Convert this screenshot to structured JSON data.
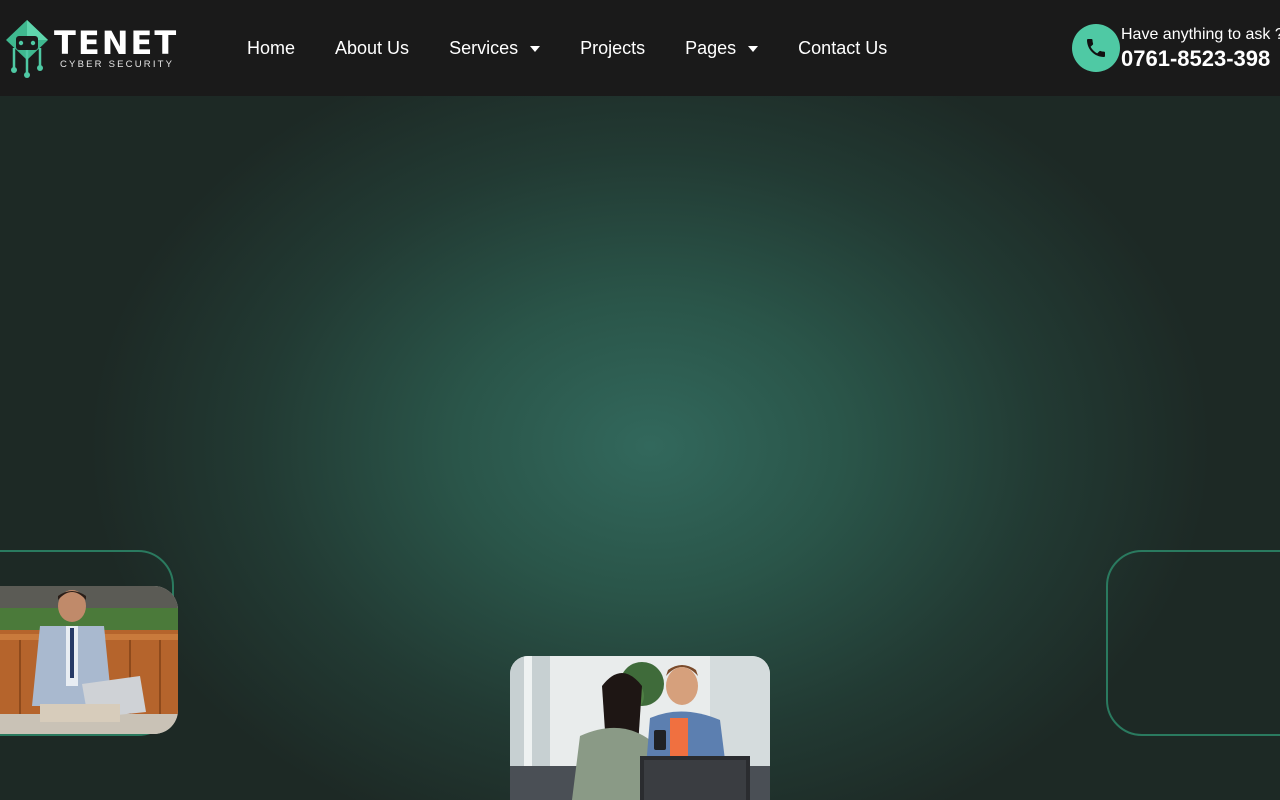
{
  "brand": {
    "name": "TENET",
    "tagline": "CYBER SECURITY",
    "accent": "#4fc9a4"
  },
  "nav": {
    "items": [
      {
        "label": "Home",
        "has_dropdown": false
      },
      {
        "label": "About Us",
        "has_dropdown": false
      },
      {
        "label": "Services",
        "has_dropdown": true
      },
      {
        "label": "Projects",
        "has_dropdown": false
      },
      {
        "label": "Pages",
        "has_dropdown": true
      },
      {
        "label": "Contact Us",
        "has_dropdown": false
      }
    ]
  },
  "contact": {
    "label": "Have anything to ask ?",
    "phone": "0761-8523-398",
    "icon": "phone-icon"
  },
  "hero": {
    "images": [
      {
        "icon": "photo-man-laptop-sofa"
      },
      {
        "icon": "photo-couple-phone-laptop"
      }
    ]
  }
}
